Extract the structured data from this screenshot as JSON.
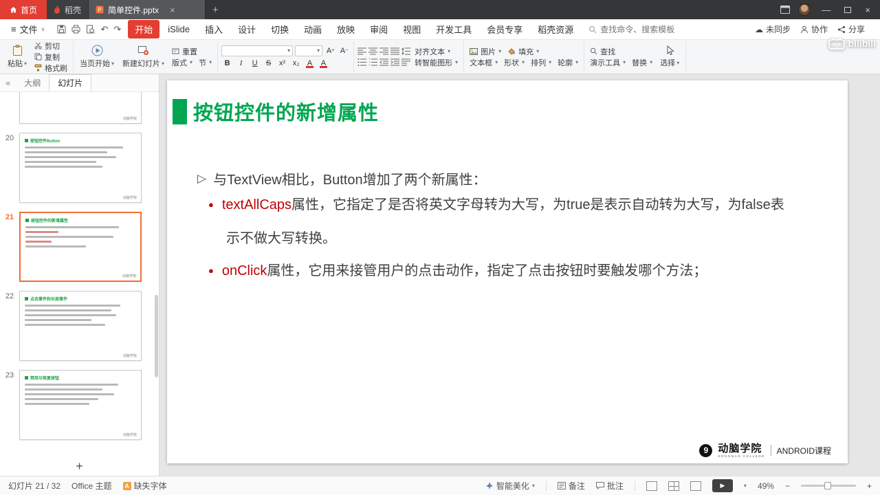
{
  "icons": {
    "dropdown": "▾",
    "menu_caret": "∨",
    "close": "×",
    "plus": "+",
    "minus": "−",
    "undo": "↶",
    "redo": "↷",
    "play": "▶",
    "bullet_dot": "●",
    "bullet_arrow": "▷",
    "collapse": "«",
    "hamburger": "≡",
    "cloud": "☁",
    "restore": "▢",
    "minimize": "—"
  },
  "titlebar": {
    "home": "首页",
    "daoke": "稻壳",
    "doc_tab": "简单控件.pptx",
    "watermark": "bilibili"
  },
  "menubar": {
    "file": "文件",
    "tabs": [
      "开始",
      "iSlide",
      "插入",
      "设计",
      "切换",
      "动画",
      "放映",
      "审阅",
      "视图",
      "开发工具",
      "会员专享",
      "稻壳资源"
    ],
    "search_placeholder": "查找命令、搜索模板",
    "sync": "未同步",
    "collaborate": "协作",
    "share": "分享"
  },
  "ribbon": {
    "paste": "粘贴",
    "cut": "剪切",
    "copy": "复制",
    "format_painter": "格式刷",
    "from_current": "当页开始",
    "new_slide": "新建幻灯片",
    "reset": "重置",
    "layout": "版式",
    "section": "节",
    "bold": "B",
    "italic": "I",
    "underline": "U",
    "strike": "S",
    "superscript": "x²",
    "subscript": "x₂",
    "font_color": "A",
    "grow_font": "A",
    "shrink_font": "A",
    "smart_graphic": "转智能图形",
    "align_text": "对齐文本",
    "textbox": "文本框",
    "shapes": "形状",
    "arrange": "排列",
    "picture": "图片",
    "outline": "轮廓",
    "fill": "填充",
    "tools": "演示工具",
    "replace": "替换",
    "find": "查找",
    "select": "选择"
  },
  "sidebar": {
    "tab_outline": "大纲",
    "tab_slides": "幻灯片",
    "thumbnails": [
      {
        "num": "",
        "title": ""
      },
      {
        "num": "20",
        "title": "按钮控件Button"
      },
      {
        "num": "21",
        "title": "按钮控件的新增属性"
      },
      {
        "num": "22",
        "title": "点击事件和长按事件"
      },
      {
        "num": "23",
        "title": "禁用与恢复按钮"
      }
    ]
  },
  "slide": {
    "title": "按钮控件的新增属性",
    "intro": "与TextView相比，Button增加了两个新属性：",
    "bullets": [
      {
        "lead": "textAllCaps",
        "line1": "属性，它指定了是否将英文字母转为大写，为true是表示自动转为大写，为false表",
        "line2": "示不做大写转换。"
      },
      {
        "lead": "onClick",
        "line1": "属性，它用来接管用户的点击动作，指定了点击按钮时要触发哪个方法；",
        "line2": ""
      }
    ],
    "brand": "动脑学院",
    "brand_sub": "DONGNAO COLLEGE",
    "course": "ANDROID课程",
    "logo_glyph": "9"
  },
  "statusbar": {
    "slide_counter": "幻灯片 21 / 32",
    "theme": "Office 主题",
    "missing_font": "缺失字体",
    "beautify": "智能美化",
    "notes": "备注",
    "comments": "批注",
    "zoom": "49%"
  }
}
